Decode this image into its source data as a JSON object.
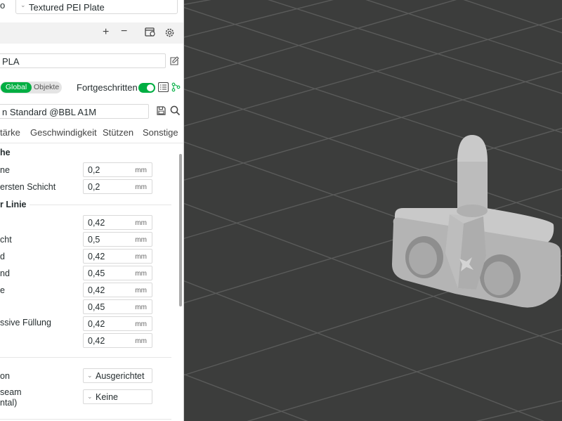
{
  "bed_panel": {
    "label_fragment": "o",
    "plate_type": "Textured PEI Plate"
  },
  "filament": {
    "value": "PLA"
  },
  "process": {
    "mode_global": "Global",
    "mode_objects": "Objekte",
    "advanced_label": "Fortgeschritten",
    "advanced_enabled": true,
    "profile": "n Standard @BBL A1M",
    "tabs": [
      "tärke",
      "Geschwindigkeit",
      "Stützen",
      "Sonstige"
    ]
  },
  "sections": {
    "layer_height": {
      "title": "he",
      "rows": [
        {
          "label": "ne",
          "value": "0,2",
          "unit": "mm"
        },
        {
          "label": "ersten Schicht",
          "value": "0,2",
          "unit": "mm"
        }
      ]
    },
    "line_width": {
      "title": "r Linie",
      "rows": [
        {
          "label": "",
          "value": "0,42",
          "unit": "mm"
        },
        {
          "label": "cht",
          "value": "0,5",
          "unit": "mm"
        },
        {
          "label": "d",
          "value": "0,42",
          "unit": "mm"
        },
        {
          "label": "nd",
          "value": "0,45",
          "unit": "mm"
        },
        {
          "label": "e",
          "value": "0,42",
          "unit": "mm"
        },
        {
          "label": "",
          "value": "0,45",
          "unit": "mm"
        },
        {
          "label": "ssive Füllung",
          "value": "0,42",
          "unit": "mm"
        },
        {
          "label": "",
          "value": "0,42",
          "unit": "mm"
        }
      ]
    },
    "seam": {
      "rows": [
        {
          "label": "on",
          "value": "Ausgerichtet"
        },
        {
          "label": "seam",
          "label2": "ntal)",
          "value": "Keine"
        }
      ]
    }
  },
  "colors": {
    "accent": "#00ae42",
    "viewport_bg": "#3c3d3c",
    "grid_line": "#5a5b5a",
    "model": "#c9c9c9"
  },
  "icons": [
    "chevron-down-icon",
    "plus-icon",
    "minus-icon",
    "plate-settings-icon",
    "gear-icon",
    "edit-icon",
    "save-icon",
    "search-icon",
    "list-icon",
    "compare-icon"
  ]
}
